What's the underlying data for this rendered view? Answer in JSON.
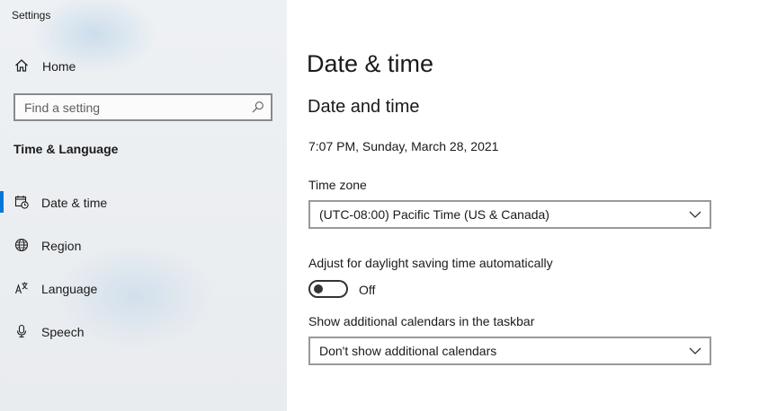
{
  "app": {
    "title": "Settings"
  },
  "sidebar": {
    "home_label": "Home",
    "search_placeholder": "Find a setting",
    "section_title": "Time & Language",
    "items": [
      {
        "label": "Date & time",
        "icon": "calendar-clock-icon",
        "active": true
      },
      {
        "label": "Region",
        "icon": "globe-icon",
        "active": false
      },
      {
        "label": "Language",
        "icon": "language-icon",
        "active": false
      },
      {
        "label": "Speech",
        "icon": "microphone-icon",
        "active": false
      }
    ],
    "accent_color": "#0078d7"
  },
  "main": {
    "page_title": "Date & time",
    "section_title": "Date and time",
    "current_datetime": "7:07 PM, Sunday, March 28, 2021",
    "timezone": {
      "label": "Time zone",
      "value": "(UTC-08:00) Pacific Time (US & Canada)"
    },
    "daylight_saving": {
      "label": "Adjust for daylight saving time automatically",
      "state": "Off"
    },
    "calendars": {
      "label": "Show additional calendars in the taskbar",
      "value": "Don't show additional calendars"
    }
  }
}
